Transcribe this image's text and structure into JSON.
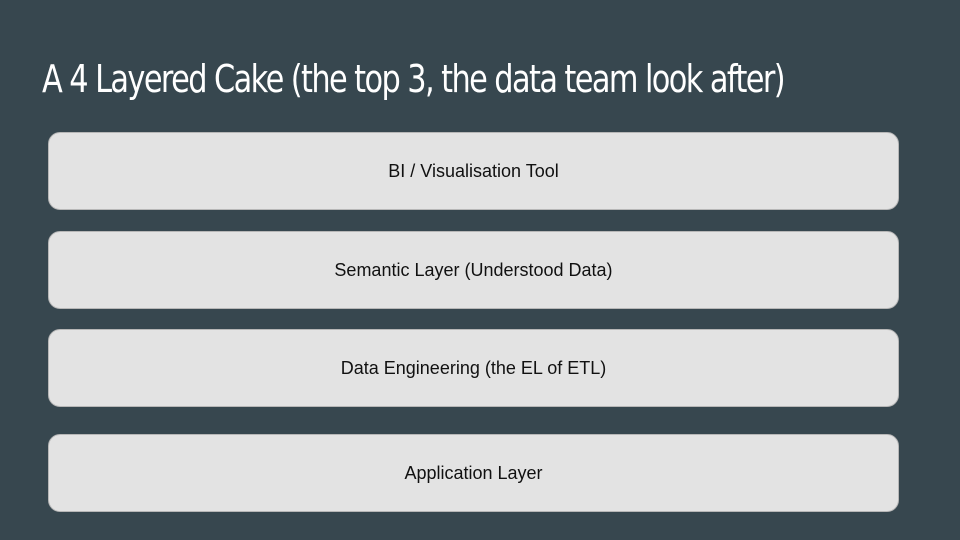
{
  "slide": {
    "title": "A 4 Layered Cake (the top 3, the data team look after)",
    "layers": [
      "BI / Visualisation Tool",
      "Semantic Layer (Understood Data)",
      "Data Engineering (the EL of ETL)",
      "Application Layer"
    ]
  },
  "colors": {
    "background": "#37474f",
    "title_text": "#ffffff",
    "layer_fill": "#e3e3e3",
    "layer_border": "#b7b7b7",
    "layer_text": "#111111"
  }
}
